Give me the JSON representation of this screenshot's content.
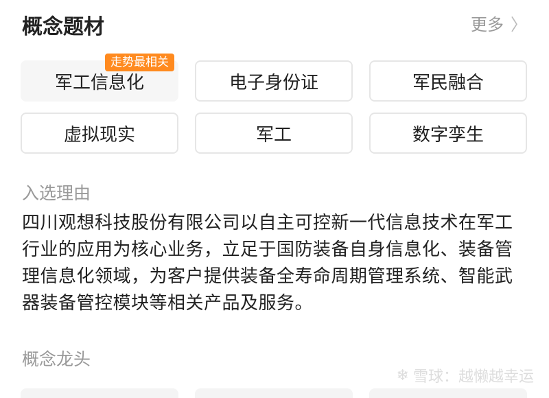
{
  "header": {
    "title": "概念题材",
    "more_label": "更多"
  },
  "tags": [
    {
      "label": "军工信息化",
      "badge": "走势最相关"
    },
    {
      "label": "电子身份证"
    },
    {
      "label": "军民融合"
    },
    {
      "label": "虚拟现实"
    },
    {
      "label": "军工"
    },
    {
      "label": "数字孪生"
    }
  ],
  "reason": {
    "title": "入选理由",
    "text": "四川观想科技股份有限公司以自主可控新一代信息技术在军工行业的应用为核心业务，立足于国防装备自身信息化、装备管理信息化领域，为客户提供装备全寿命周期管理系统、智能武器装备管控模块等相关产品及服务。"
  },
  "leaders": {
    "title": "概念龙头"
  },
  "watermark": {
    "text": "雪球：越懒越幸运"
  },
  "colors": {
    "badge": "#ff8a1f",
    "muted": "#999999"
  }
}
